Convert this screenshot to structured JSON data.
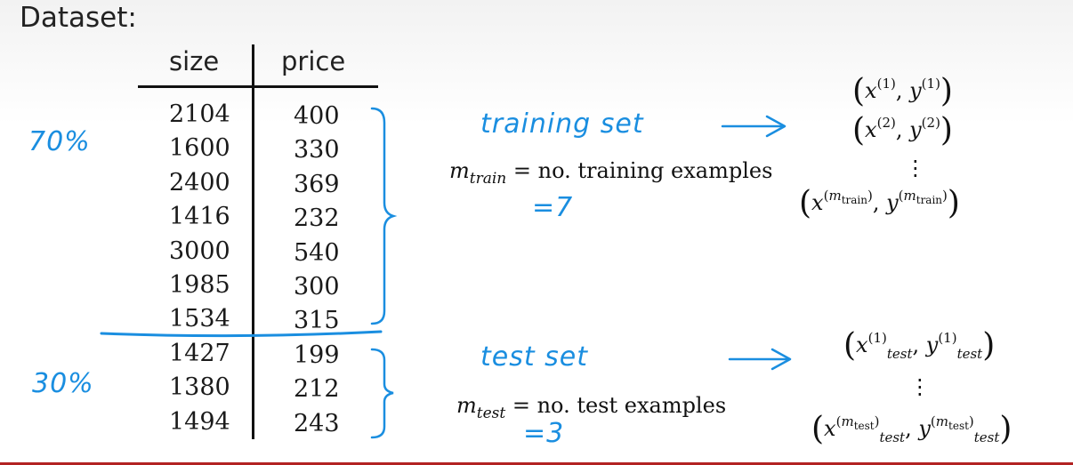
{
  "heading": "Dataset:",
  "table": {
    "columns": [
      "size",
      "price"
    ],
    "rows": [
      [
        "2104",
        "400"
      ],
      [
        "1600",
        "330"
      ],
      [
        "2400",
        "369"
      ],
      [
        "1416",
        "232"
      ],
      [
        "3000",
        "540"
      ],
      [
        "1985",
        "300"
      ],
      [
        "1534",
        "315"
      ],
      [
        "1427",
        "199"
      ],
      [
        "1380",
        "212"
      ],
      [
        "1494",
        "243"
      ]
    ]
  },
  "annotations": {
    "train_pct": "70%",
    "test_pct": "30%",
    "training_set_label": "training set",
    "test_set_label": "test set",
    "train_def_var": "m",
    "train_def_sub": "train",
    "train_def_text": " = no. training examples",
    "train_count": "=7",
    "test_def_var": "m",
    "test_def_sub": "test",
    "test_def_text": " = no. test examples",
    "test_count": "=3"
  },
  "colors": {
    "ink_blue": "#1a8ee0",
    "text": "#1a1a1a"
  }
}
